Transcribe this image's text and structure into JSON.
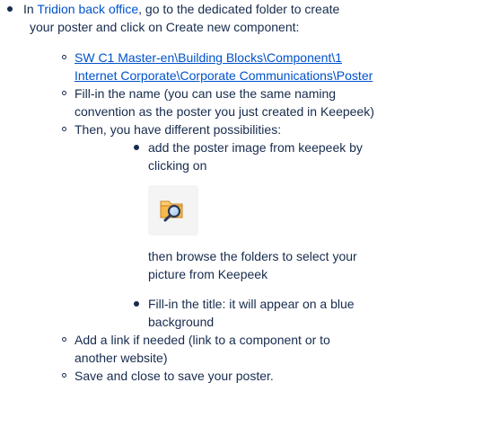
{
  "step1": {
    "prefix": "In ",
    "link_text": "Tridion back office",
    "line1_suffix": ", go to the dedicated folder to create",
    "line2": "your poster and click on Create new component:"
  },
  "sub_items": {
    "folder_path_line1": "SW C1 Master-en\\Building Blocks\\Component\\1 ",
    "folder_path_line2": "Internet Corporate\\Corporate Communications\\Poster",
    "fill_name_line1": "Fill-in the name (you can use the same naming",
    "fill_name_line2": "convention as the poster you just created in Keepeek)",
    "possibilities": "Then, you have different possibilities:",
    "add_link_line1": "Add a link if needed (link to a component or to",
    "add_link_line2": "another website)",
    "save_close": "Save and close to save your poster."
  },
  "nested": {
    "add_image_line1": "add the poster image from keepeek by",
    "add_image_line2": "clicking on",
    "browse_line1": "then browse the folders to select your",
    "browse_line2": "picture from Keepeek",
    "title_line1": "Fill-in the title: it will appear on a blue",
    "title_line2": "background"
  },
  "icons": {
    "browse_button_icon": "folder-search-icon"
  },
  "colors": {
    "text": "#172b4d",
    "link": "#0052cc"
  }
}
